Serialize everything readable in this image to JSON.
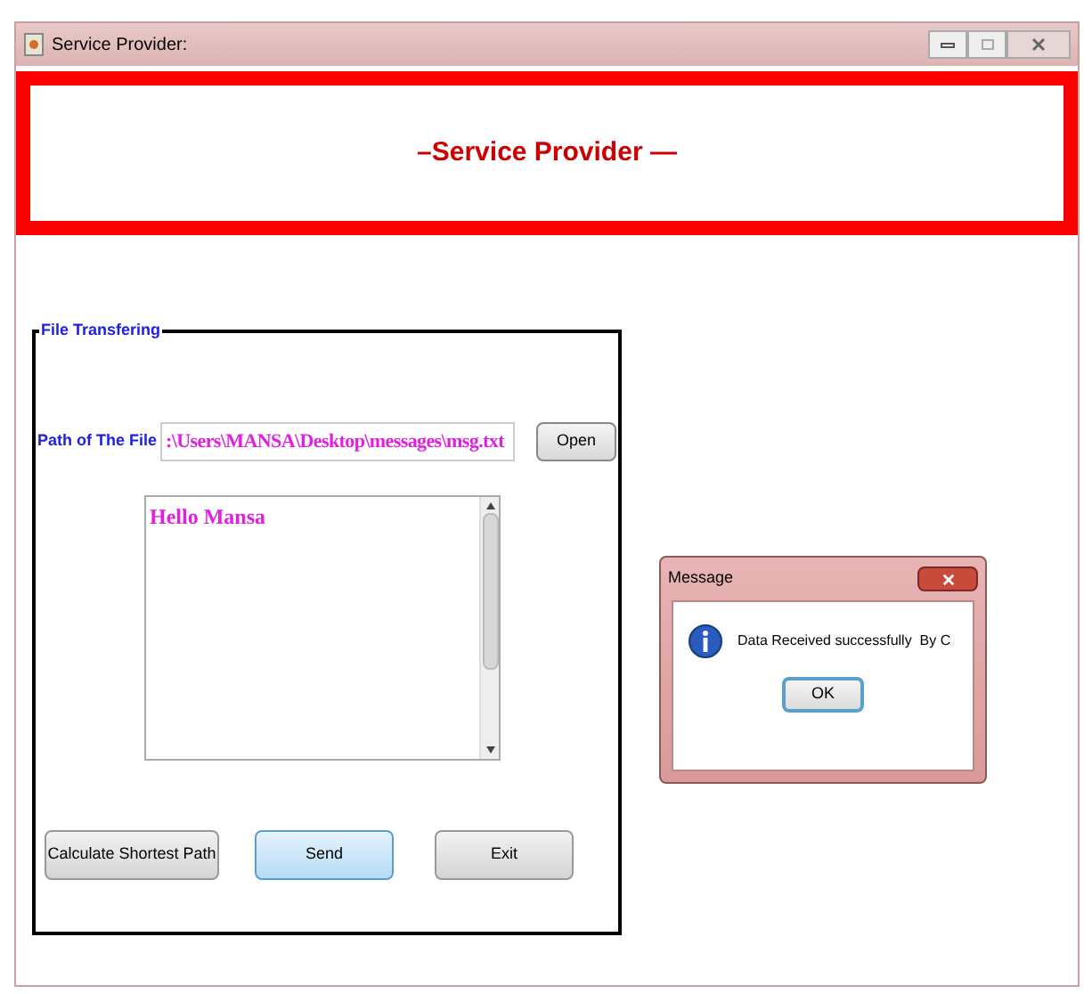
{
  "window": {
    "title": "Service Provider:"
  },
  "banner": {
    "title": "–Service Provider —"
  },
  "group": {
    "title": "File Transfering",
    "path_label": "Path of The File",
    "path_value": ":\\Users\\MANSA\\Desktop\\messages\\msg.txt",
    "open_button": "Open",
    "message_text": "Hello Mansa",
    "buttons": [
      {
        "label": "Calculate Shortest Path",
        "selected": false
      },
      {
        "label": "Send",
        "selected": true
      },
      {
        "label": "Exit",
        "selected": false
      }
    ]
  },
  "dialog": {
    "title": "Message",
    "text": "Data Received successfully  By C",
    "ok_button": "OK"
  }
}
